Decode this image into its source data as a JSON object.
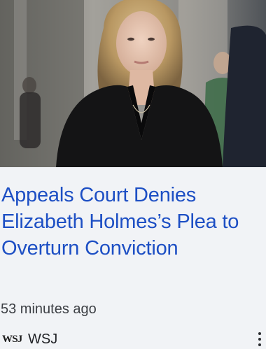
{
  "article": {
    "headline": "Appeals Court Denies Elizabeth Holmes’s Plea to Overturn Conviction",
    "time_ago": "53 minutes ago",
    "source_logo": "WSJ",
    "source_name": "WSJ",
    "more_icon": "more-vert-icon"
  },
  "colors": {
    "headline": "#1d4fc4",
    "card_background": "#f1f3f6",
    "meta_text": "#3c3f44"
  }
}
